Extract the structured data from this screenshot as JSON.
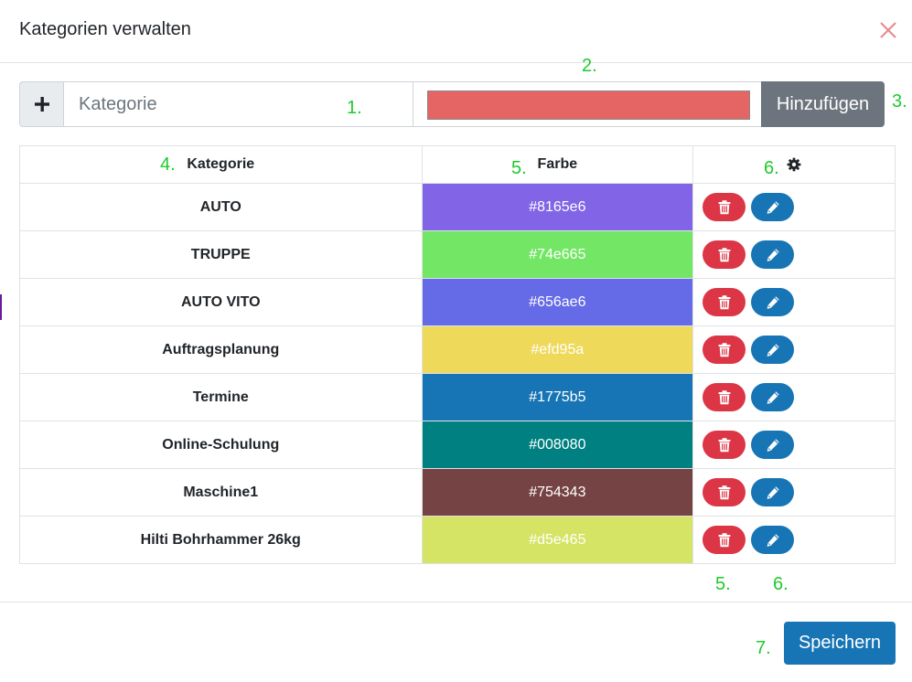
{
  "modal": {
    "title": "Kategorien verwalten"
  },
  "add_form": {
    "placeholder": "Kategorie",
    "value": "",
    "color_value": "#e56565",
    "add_label": "Hinzufügen"
  },
  "table": {
    "headers": {
      "name": "Kategorie",
      "color": "Farbe",
      "actions_icon": "gear-icon"
    },
    "rows": [
      {
        "name": "AUTO",
        "color": "#8165e6"
      },
      {
        "name": "TRUPPE",
        "color": "#74e665"
      },
      {
        "name": "AUTO VITO",
        "color": "#656ae6"
      },
      {
        "name": "Auftragsplanung",
        "color": "#efd95a"
      },
      {
        "name": "Termine",
        "color": "#1775b5"
      },
      {
        "name": "Online-Schulung",
        "color": "#008080"
      },
      {
        "name": "Maschine1",
        "color": "#754343"
      },
      {
        "name": "Hilti Bohrhammer 26kg",
        "color": "#d5e465"
      }
    ],
    "row_actions": {
      "delete_icon": "trash-icon",
      "edit_icon": "pencil-icon"
    }
  },
  "footer": {
    "save_label": "Speichern"
  },
  "annotations": {
    "a1": "1.",
    "a2": "2.",
    "a3": "3.",
    "a4": "4.",
    "a5": "5.",
    "a6": "6.",
    "a5b": "5.",
    "a6b": "6.",
    "a7": "7."
  },
  "colors": {
    "delete": "#dc3545",
    "edit": "#1775b5",
    "add_button": "#6c757d",
    "annotation": "#1dcb2a",
    "close": "#e88a8a"
  }
}
